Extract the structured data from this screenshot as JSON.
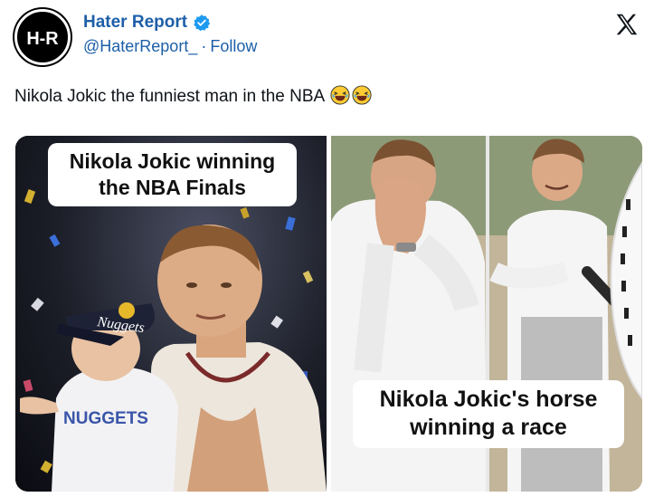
{
  "account": {
    "display_name": "Hater Report",
    "handle": "@HaterReport_",
    "separator": "·",
    "follow_label": "Follow",
    "avatar_text": "H-R"
  },
  "tweet": {
    "text": "Nikola Jokic the funniest man in the NBA",
    "emojis": [
      "laughing-emoji",
      "laughing-emoji"
    ]
  },
  "media": {
    "left_caption_line1": "Nikola Jokic winning",
    "left_caption_line2": "the NBA Finals",
    "right_caption_line1": "Nikola Jokic's horse",
    "right_caption_line2": "winning a race",
    "left_shirt_text": "NUGGETS",
    "left_cap_text": "Nuggets"
  },
  "colors": {
    "link_blue": "#1d5fa8",
    "verified_blue": "#1d9bf0",
    "text": "#0f1419"
  }
}
